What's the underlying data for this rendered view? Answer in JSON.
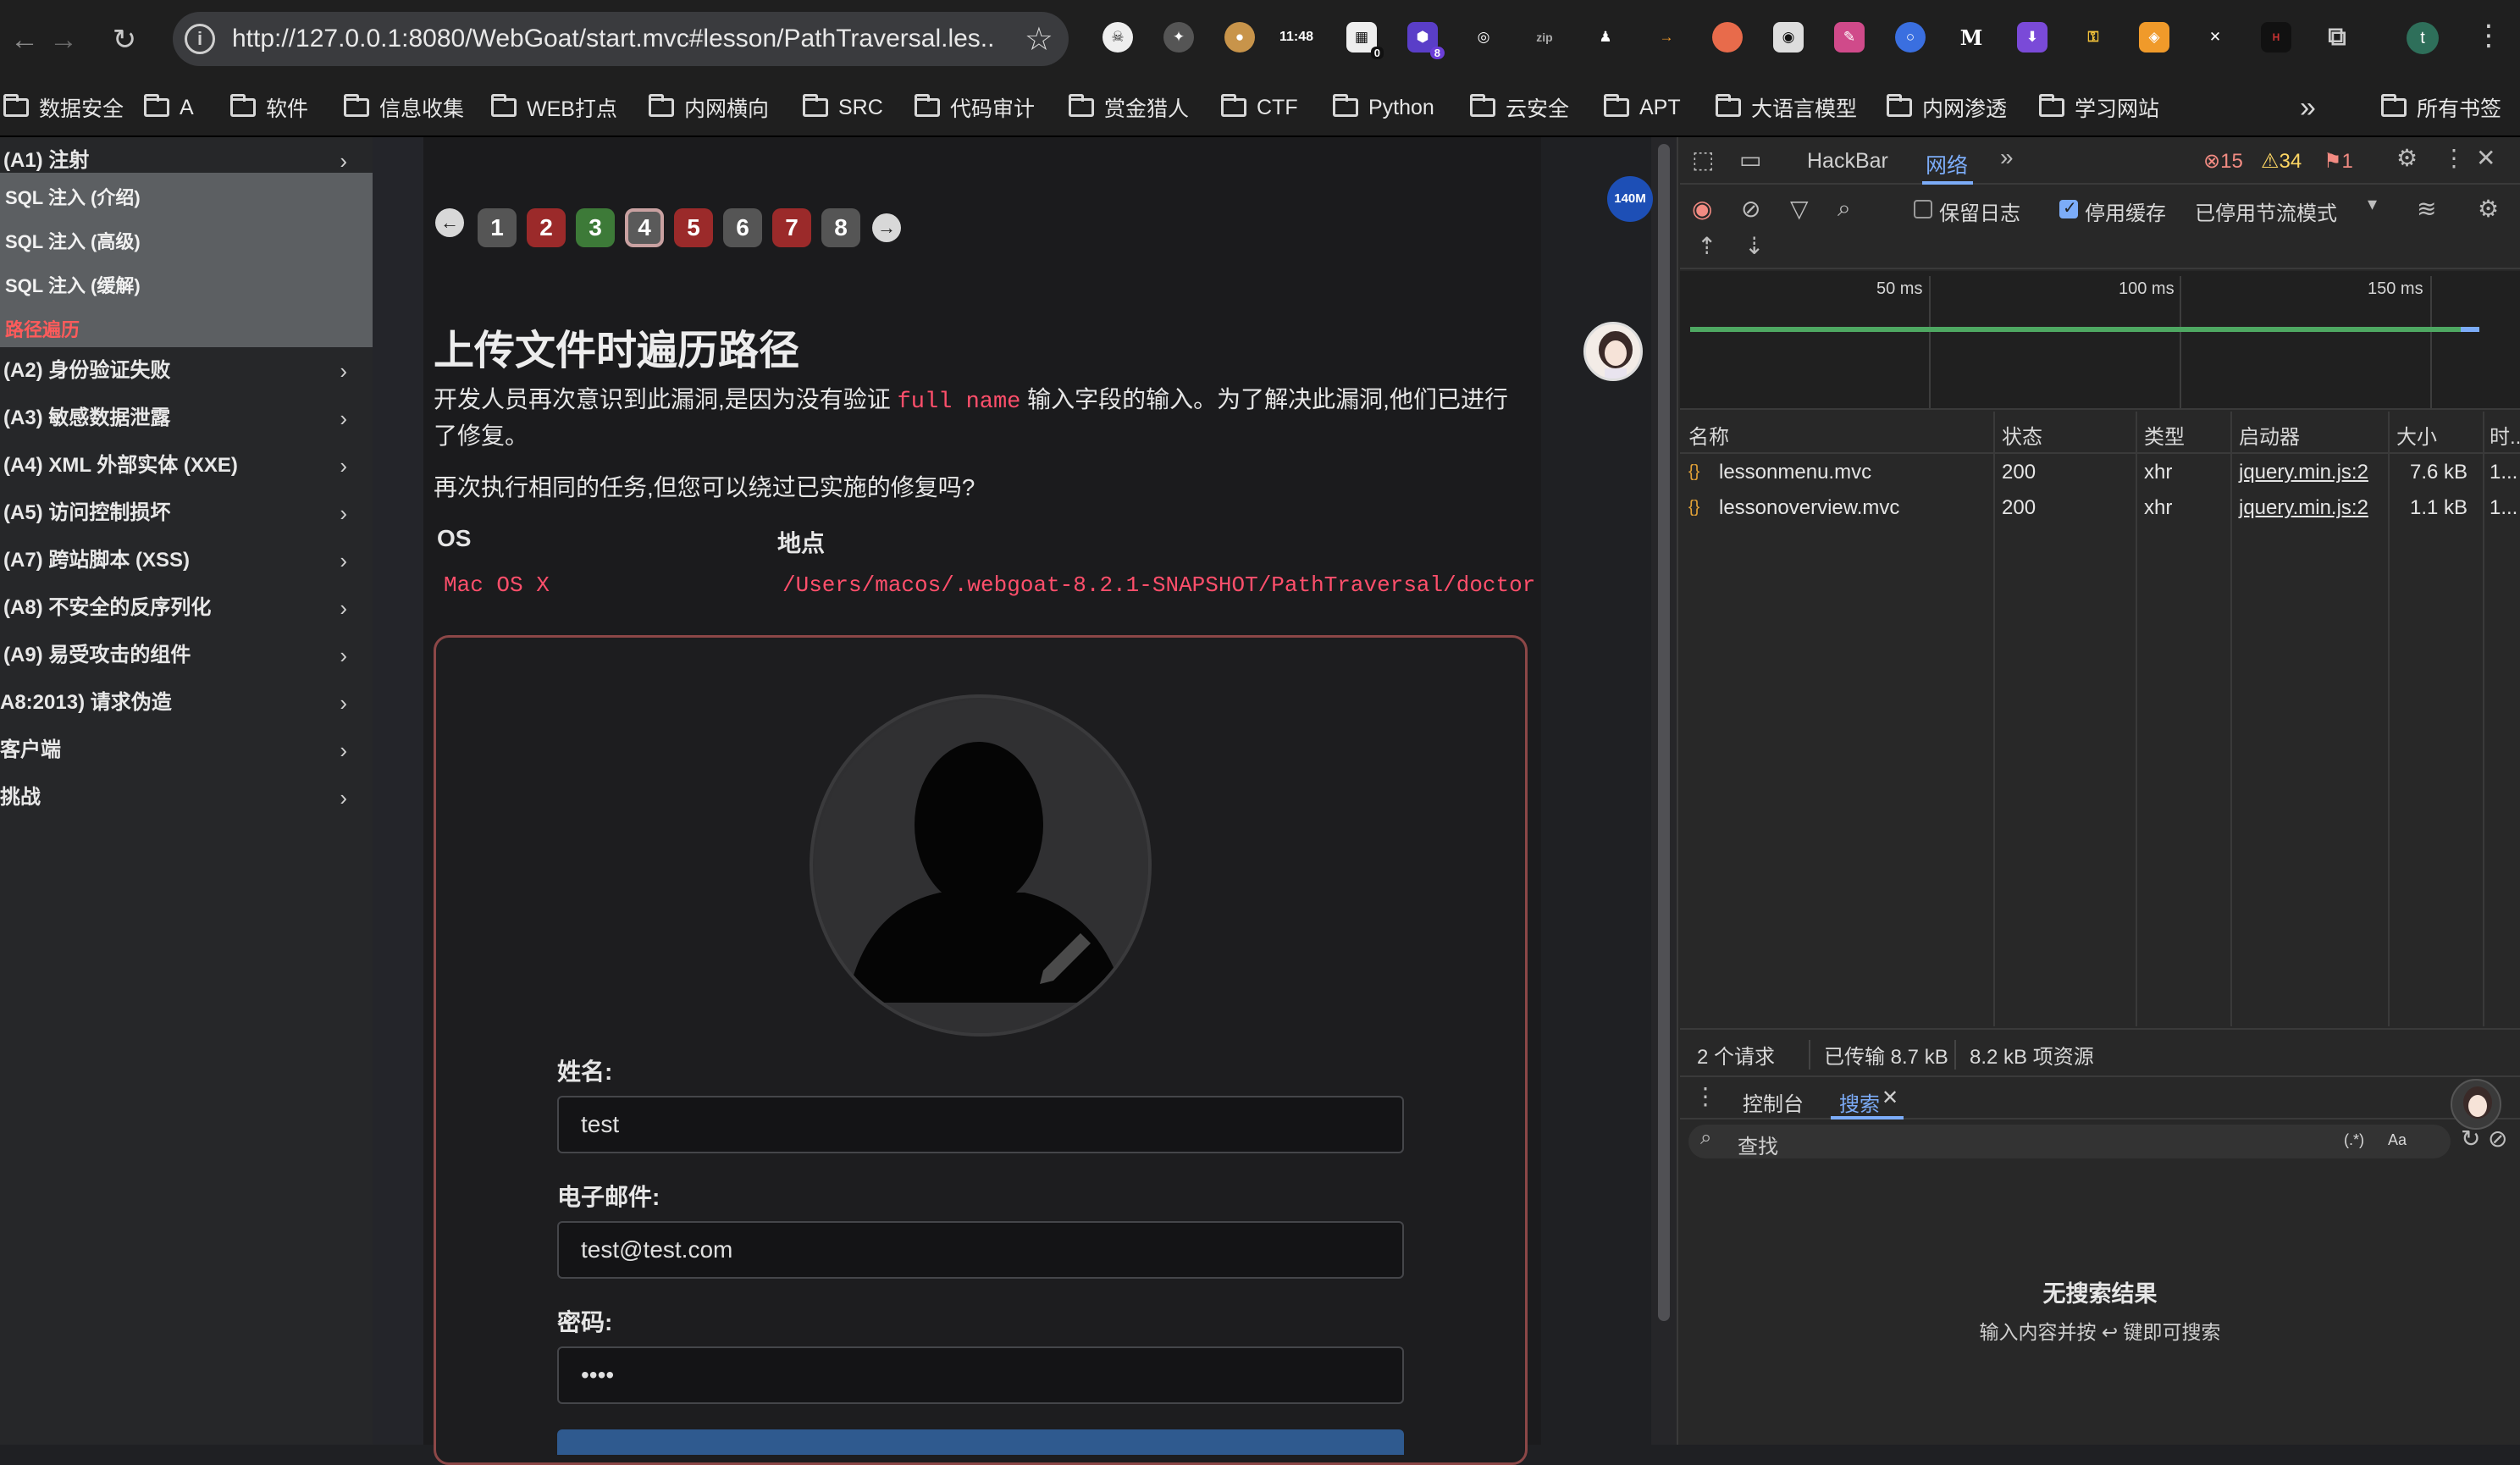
{
  "browser": {
    "url": "http://127.0.0.1:8080/WebGoat/start.mvc#lesson/PathTraversal.les...",
    "ext_clock": "11:48",
    "ext_badge_a": "0",
    "ext_badge_b": "8",
    "profile_initial": "t",
    "bookmarks": [
      "数据安全",
      "A",
      "软件",
      "信息收集",
      "WEB打点",
      "内网横向",
      "SRC",
      "代码审计",
      "赏金猎人",
      "CTF",
      "Python",
      "云安全",
      "APT",
      "大语言模型",
      "内网渗透",
      "学习网站"
    ],
    "all_bookmarks": "所有书签"
  },
  "sidebar": {
    "categories": [
      {
        "label": "(A1) 注射"
      },
      {
        "label": "(A2) 身份验证失败"
      },
      {
        "label": "(A3) 敏感数据泄露"
      },
      {
        "label": "(A4) XML 外部实体 (XXE)"
      },
      {
        "label": "(A5) 访问控制损坏"
      },
      {
        "label": "(A7) 跨站脚本 (XSS)"
      },
      {
        "label": "(A8) 不安全的反序列化"
      },
      {
        "label": "(A9) 易受攻击的组件"
      },
      {
        "label": "A8:2013) 请求伪造"
      },
      {
        "label": "客户端"
      },
      {
        "label": "挑战"
      }
    ],
    "sub_items": [
      "SQL 注入 (介绍)",
      "SQL 注入 (高级)",
      "SQL 注入 (缓解)",
      "路径遍历"
    ]
  },
  "lesson": {
    "pages": [
      "1",
      "2",
      "3",
      "4",
      "5",
      "6",
      "7",
      "8"
    ],
    "title": "上传文件时遍历路径",
    "desc_before": "开发人员再次意识到此漏洞,是因为没有验证 ",
    "desc_code": "full name",
    "desc_after": " 输入字段的输入。为了解决此漏洞,他们已进行了修复。",
    "task": "再次执行相同的任务,但您可以绕过已实施的修复吗?",
    "os_header": "OS",
    "location_header": "地点",
    "os_value": "Mac OS X",
    "location_value": "/Users/macos/.webgoat-8.2.1-SNAPSHOT/PathTraversal/doctor",
    "name_label": "姓名:",
    "name_value": "test",
    "email_label": "电子邮件:",
    "email_value": "test@test.com",
    "password_label": "密码:",
    "password_value": "••••",
    "badge": "140M"
  },
  "devtools": {
    "tabs": [
      "HackBar",
      "网络"
    ],
    "errors": "15",
    "warnings": "34",
    "issues": "1",
    "preserve_log": "保留日志",
    "disable_cache": "停用缓存",
    "throttle": "已停用节流模式",
    "timeline_ticks": [
      "50 ms",
      "100 ms",
      "150 ms"
    ],
    "columns": [
      "名称",
      "状态",
      "类型",
      "启动器",
      "大小",
      "时..."
    ],
    "rows": [
      {
        "name": "lessonmenu.mvc",
        "status": "200",
        "type": "xhr",
        "initiator": "jquery.min.js:2",
        "size": "7.6 kB",
        "time": "1..."
      },
      {
        "name": "lessonoverview.mvc",
        "status": "200",
        "type": "xhr",
        "initiator": "jquery.min.js:2",
        "size": "1.1 kB",
        "time": "1..."
      }
    ],
    "requests": "2 个请求",
    "transferred": "已传输 8.7 kB",
    "resources": "8.2 kB 项资源",
    "drawer_tabs": [
      "控制台",
      "搜索"
    ],
    "search_placeholder": "查找",
    "regex_label": "(.*)",
    "case_label": "Aa",
    "no_results": "无搜索结果",
    "no_results_hint": "输入内容并按 ↩ 键即可搜索"
  }
}
